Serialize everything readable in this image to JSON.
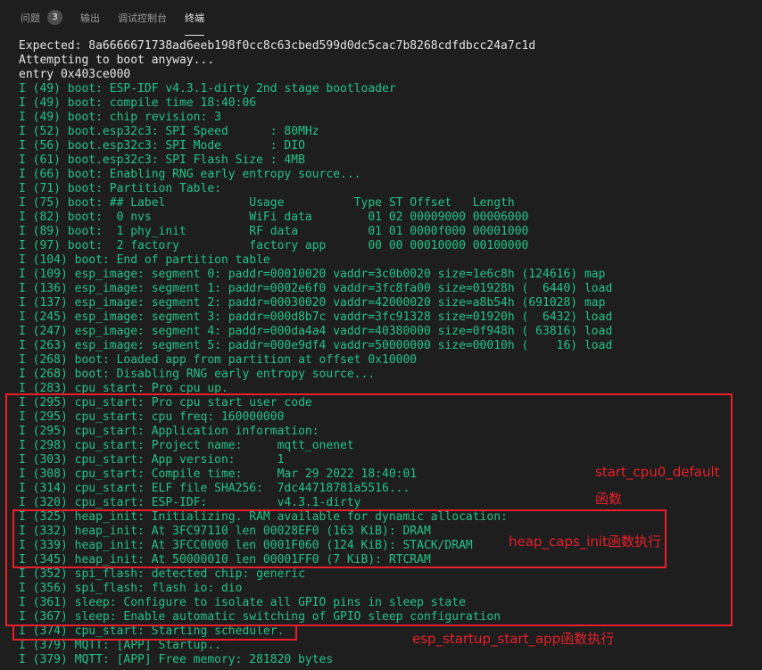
{
  "tabs": [
    {
      "label": "问题",
      "badge": "3"
    },
    {
      "label": "输出"
    },
    {
      "label": "调试控制台"
    },
    {
      "label": "终端"
    }
  ],
  "terminal": {
    "lines": [
      {
        "text": "Expected: 8a6666671738ad6eeb198f0cc8c63cbed599d0dc5cac7b8268cdfdbcc24a7c1d",
        "color": "plain"
      },
      {
        "text": "Attempting to boot anyway...",
        "color": "plain"
      },
      {
        "text": "entry 0x403ce000",
        "color": "plain"
      },
      {
        "text": "I (49) boot: ESP-IDF v4.3.1-dirty 2nd stage bootloader",
        "color": "green"
      },
      {
        "text": "I (49) boot: compile time 18:40:06",
        "color": "green"
      },
      {
        "text": "I (49) boot: chip revision: 3",
        "color": "green"
      },
      {
        "text": "I (52) boot.esp32c3: SPI Speed      : 80MHz",
        "color": "green"
      },
      {
        "text": "I (56) boot.esp32c3: SPI Mode       : DIO",
        "color": "green"
      },
      {
        "text": "I (61) boot.esp32c3: SPI Flash Size : 4MB",
        "color": "green"
      },
      {
        "text": "I (66) boot: Enabling RNG early entropy source...",
        "color": "green"
      },
      {
        "text": "I (71) boot: Partition Table:",
        "color": "green"
      },
      {
        "text": "I (75) boot: ## Label            Usage          Type ST Offset   Length",
        "color": "green"
      },
      {
        "text": "I (82) boot:  0 nvs              WiFi data        01 02 00009000 00006000",
        "color": "green"
      },
      {
        "text": "I (89) boot:  1 phy_init         RF data          01 01 0000f000 00001000",
        "color": "green"
      },
      {
        "text": "I (97) boot:  2 factory          factory app      00 00 00010000 00100000",
        "color": "green"
      },
      {
        "text": "I (104) boot: End of partition table",
        "color": "green"
      },
      {
        "text": "I (109) esp_image: segment 0: paddr=00010020 vaddr=3c0b0020 size=1e6c8h (124616) map",
        "color": "green"
      },
      {
        "text": "I (136) esp_image: segment 1: paddr=0002e6f0 vaddr=3fc8fa00 size=01928h (  6440) load",
        "color": "green"
      },
      {
        "text": "I (137) esp_image: segment 2: paddr=00030020 vaddr=42000020 size=a8b54h (691028) map",
        "color": "green"
      },
      {
        "text": "I (245) esp_image: segment 3: paddr=000d8b7c vaddr=3fc91328 size=01920h (  6432) load",
        "color": "green"
      },
      {
        "text": "I (247) esp_image: segment 4: paddr=000da4a4 vaddr=40380000 size=0f948h ( 63816) load",
        "color": "green"
      },
      {
        "text": "I (263) esp_image: segment 5: paddr=000e9df4 vaddr=50000000 size=00010h (    16) load",
        "color": "green"
      },
      {
        "text": "I (268) boot: Loaded app from partition at offset 0x10000",
        "color": "green"
      },
      {
        "text": "I (268) boot: Disabling RNG early entropy source...",
        "color": "green"
      },
      {
        "text": "I (283) cpu_start: Pro cpu up.",
        "color": "green"
      },
      {
        "text": "I (295) cpu_start: Pro cpu start user code",
        "color": "green"
      },
      {
        "text": "I (295) cpu_start: cpu freq: 160000000",
        "color": "green"
      },
      {
        "text": "I (295) cpu_start: Application information:",
        "color": "green"
      },
      {
        "text": "I (298) cpu_start: Project name:     mqtt_onenet",
        "color": "green"
      },
      {
        "text": "I (303) cpu_start: App version:      1",
        "color": "green"
      },
      {
        "text": "I (308) cpu_start: Compile time:     Mar 29 2022 18:40:01",
        "color": "green"
      },
      {
        "text": "I (314) cpu_start: ELF file SHA256:  7dc44718781a5516...",
        "color": "green"
      },
      {
        "text": "I (320) cpu_start: ESP-IDF:          v4.3.1-dirty",
        "color": "green"
      },
      {
        "text": "I (325) heap_init: Initializing. RAM available for dynamic allocation:",
        "color": "green"
      },
      {
        "text": "I (332) heap_init: At 3FC97110 len 00028EF0 (163 KiB): DRAM",
        "color": "green"
      },
      {
        "text": "I (339) heap_init: At 3FCC0000 len 0001F060 (124 KiB): STACK/DRAM",
        "color": "green"
      },
      {
        "text": "I (345) heap_init: At 50000010 len 00001FF0 (7 KiB): RTCRAM",
        "color": "green"
      },
      {
        "text": "I (352) spi_flash: detected chip: generic",
        "color": "green"
      },
      {
        "text": "I (356) spi_flash: flash io: dio",
        "color": "green"
      },
      {
        "text": "I (361) sleep: Configure to isolate all GPIO pins in sleep state",
        "color": "green"
      },
      {
        "text": "I (367) sleep: Enable automatic switching of GPIO sleep configuration",
        "color": "green"
      },
      {
        "text": "I (374) cpu_start: Starting scheduler.",
        "color": "green"
      },
      {
        "text": "I (379) MQTT: [APP] Startup..",
        "color": "green"
      },
      {
        "text": "I (379) MQTT: [APP] Free memory: 281820 bytes",
        "color": "green"
      }
    ]
  },
  "annotations": {
    "cpu0_label_line1": "start_cpu0_default",
    "cpu0_label_line2": "函数",
    "heap_label": "heap_caps_init函数执行",
    "app_label": "esp_startup_start_app函数执行"
  },
  "colors": {
    "background": "#1e1e1e",
    "log_green": "#23c38b",
    "plain_text": "#e5e5e5",
    "annotation_red": "#e8202a"
  }
}
